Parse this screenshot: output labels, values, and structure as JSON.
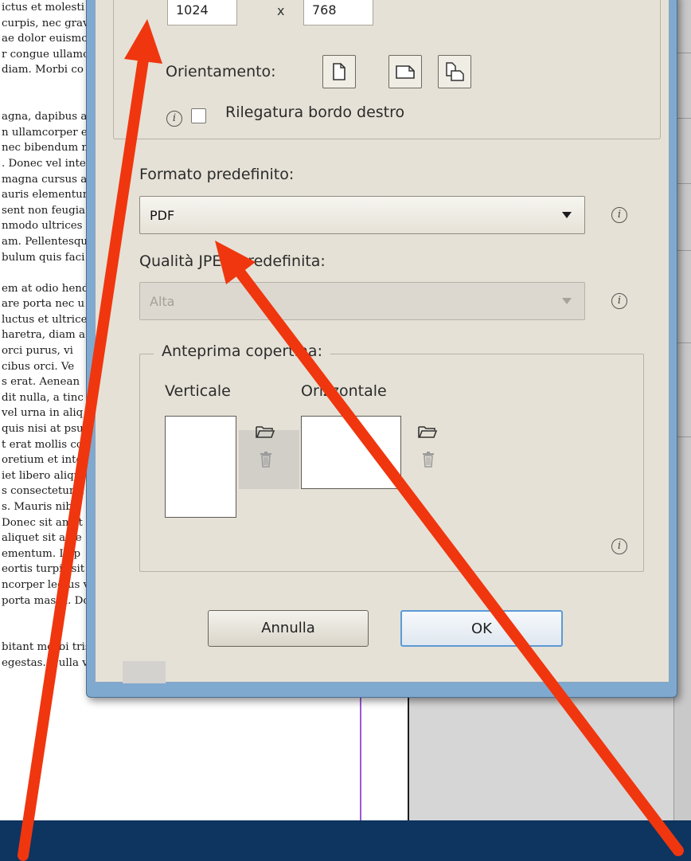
{
  "document": {
    "lines": [
      "ictus et molesti",
      "curpis, nec gravi",
      "ae dolor euismo",
      "r congue ullamco",
      " diam. Morbi co",
      "",
      "",
      "agna, dapibus a",
      "n ullamcorper ei",
      "nec bibendum n",
      ". Donec vel inte",
      " magna cursus a",
      "auris elementum",
      "sent non feugia",
      "nmodo ultrices e",
      "am. Pellentesque",
      "bulum quis faci",
      "",
      "em at odio hendr",
      "are porta nec u",
      "luctus et ultrices",
      "haretra, diam a",
      " orci purus, vi",
      "cibus orci. Ve",
      "s erat. Aenean",
      "dit nulla, a tinc",
      "vel urna in aliq",
      "quis nisi at psu",
      "t erat mollis co",
      "oretium et inte",
      "iet libero aliqu",
      "s consectetur a",
      "s. Mauris nibh",
      "Donec sit amet",
      " aliquet sit ame",
      "ementum. In p",
      "eortis turpis sit amet fringilla tempus. Sed semper purus",
      "ncorper lectus vestibulum sit amet. Morbi sit amet su-",
      "porta massa. Donec pellentesque consequat neque quis",
      "",
      "",
      "bitant morbi tristique senectus et netus et malesuada",
      "egestas. Nulla vel justo nisi. Pellentesque ullamcorper"
    ]
  },
  "dialog": {
    "width_value": "1024",
    "height_value": "768",
    "times_sign": "x",
    "orientation_label": "Orientamento:",
    "orientation_buttons": [
      "portrait-page-icon",
      "landscape-page-icon",
      "both-orientations-icon"
    ],
    "right_edge_binding_label": "Rilegatura bordo destro",
    "right_edge_binding_checked": false,
    "default_format_label": "Formato predefinito:",
    "default_format_value": "PDF",
    "jpeg_quality_label": "Qualità JPEG predefinita:",
    "jpeg_quality_value": "Alta",
    "jpeg_quality_disabled": true,
    "cover_preview_label": "Anteprima copertina:",
    "vertical_label": "Verticale",
    "horizontal_label": "Orizzontale",
    "cancel_label": "Annulla",
    "ok_label": "OK",
    "info_glyph": "i"
  },
  "annotation": {
    "arrow_color": "#f0360f",
    "arrow_count": 3
  },
  "colors": {
    "dialog_face": "#e5e1d6",
    "window_frame": "#7fa9cf",
    "bottom_bar": "#0e3460",
    "primary_button_border": "#5c9ad6"
  }
}
